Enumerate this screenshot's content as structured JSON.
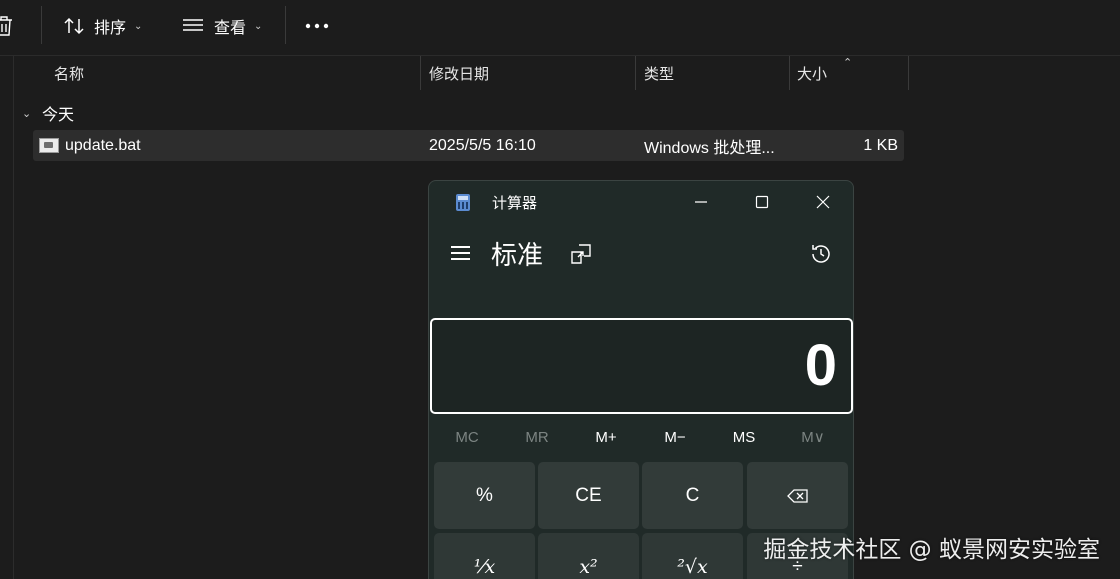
{
  "toolbar": {
    "sort_label": "排序",
    "view_label": "查看"
  },
  "columns": {
    "name": "名称",
    "modified": "修改日期",
    "type": "类型",
    "size": "大小"
  },
  "group": {
    "label": "今天"
  },
  "file": {
    "name": "update.bat",
    "modified": "2025/5/5 16:10",
    "type": "Windows 批处理...",
    "size": "1 KB"
  },
  "calculator": {
    "title": "计算器",
    "mode": "标准",
    "display_value": "0",
    "memory": [
      "MC",
      "MR",
      "M+",
      "M−",
      "MS",
      "M∨"
    ],
    "keys_row1": [
      "%",
      "CE",
      "C"
    ],
    "keys_row2": [
      "¹⁄x",
      "x²",
      "²√x",
      "÷"
    ]
  },
  "watermark": "掘金技术社区 @ 蚁景网安实验室",
  "colors": {
    "background": "#1c1c1c",
    "calc_window": "#202a28",
    "calc_key": "#323b39",
    "selected_row": "#2d2d2d"
  }
}
